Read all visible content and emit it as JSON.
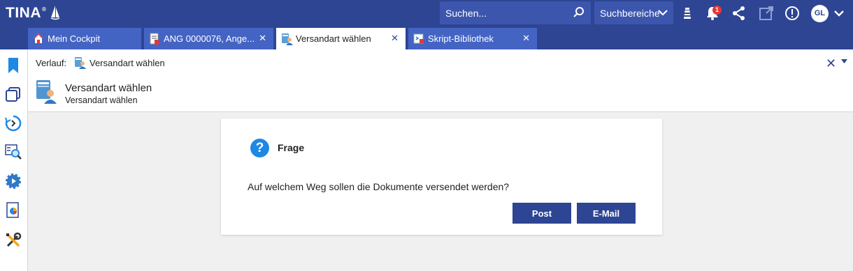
{
  "app": {
    "name": "TINA",
    "trademark": "®"
  },
  "search": {
    "placeholder": "Suchen..."
  },
  "scope": {
    "label": "Suchbereiche"
  },
  "notifications": {
    "count": "1"
  },
  "user": {
    "initials": "GL"
  },
  "tabs": [
    {
      "label": "Mein Cockpit",
      "closable": false,
      "active": false
    },
    {
      "label": "ANG 0000076, Ange...",
      "closable": true,
      "active": false
    },
    {
      "label": "Versandart wählen",
      "closable": true,
      "active": true
    },
    {
      "label": "Skript-Bibliothek",
      "closable": true,
      "active": false
    }
  ],
  "close_glyph": "✕",
  "breadcrumb": {
    "label": "Verlauf:",
    "item": "Versandart wählen"
  },
  "header": {
    "title": "Versandart wählen",
    "subtitle": "Versandart wählen"
  },
  "dialog": {
    "icon_glyph": "?",
    "title": "Frage",
    "question": "Auf welchem Weg sollen die Dokumente versendet werden?",
    "buttons": {
      "post": "Post",
      "email": "E-Mail"
    }
  },
  "colors": {
    "brand": "#2e4594",
    "tab_inactive": "#4464c4",
    "accent": "#1e88e5",
    "badge": "#e53935"
  },
  "icons": {
    "topbar": [
      "search-icon",
      "chevron-down-icon",
      "lighthouse-icon",
      "bell-icon",
      "share-icon",
      "external-link-icon",
      "info-icon",
      "chevron-down-icon"
    ],
    "sidebar": [
      "bookmark-icon",
      "windows-icon",
      "history-icon",
      "search-list-icon",
      "gear-play-icon",
      "report-icon",
      "tools-icon"
    ]
  }
}
